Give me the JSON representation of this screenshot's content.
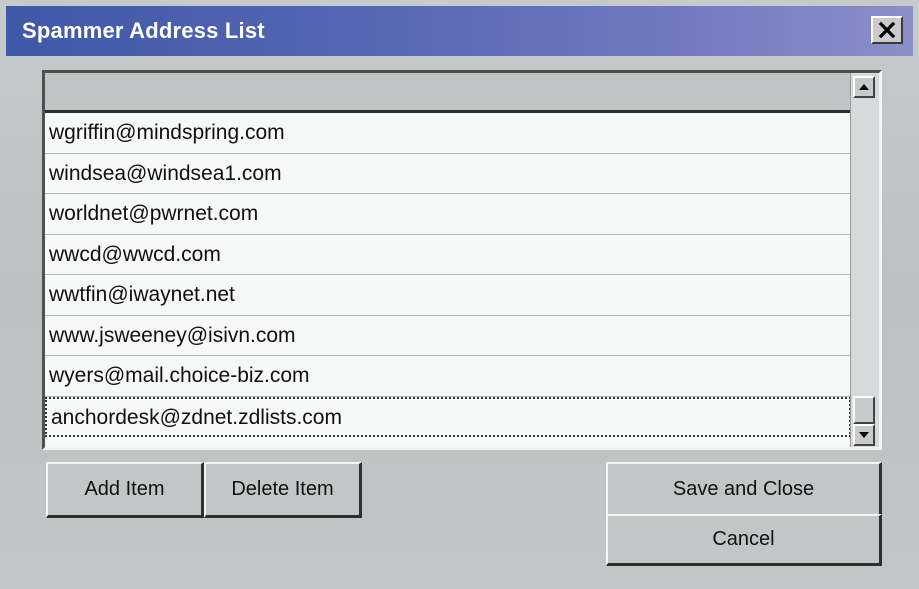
{
  "window": {
    "title": "Spammer Address List",
    "close_icon": "close-icon"
  },
  "list": {
    "items": [
      "wgriffin@mindspring.com",
      "windsea@windsea1.com",
      "worldnet@pwrnet.com",
      "wwcd@wwcd.com",
      "wwtfin@iwaynet.net",
      "www.jsweeney@isivn.com",
      "wyers@mail.choice-biz.com",
      "anchordesk@zdnet.zdlists.com"
    ],
    "selected_index": 7
  },
  "buttons": {
    "add": "Add Item",
    "delete": "Delete Item",
    "save_close": "Save and Close",
    "cancel": "Cancel"
  },
  "colors": {
    "titlebar_start": "#3f58a8",
    "titlebar_end": "#8a8fc8",
    "dialog_bg": "#bfc3c4"
  }
}
